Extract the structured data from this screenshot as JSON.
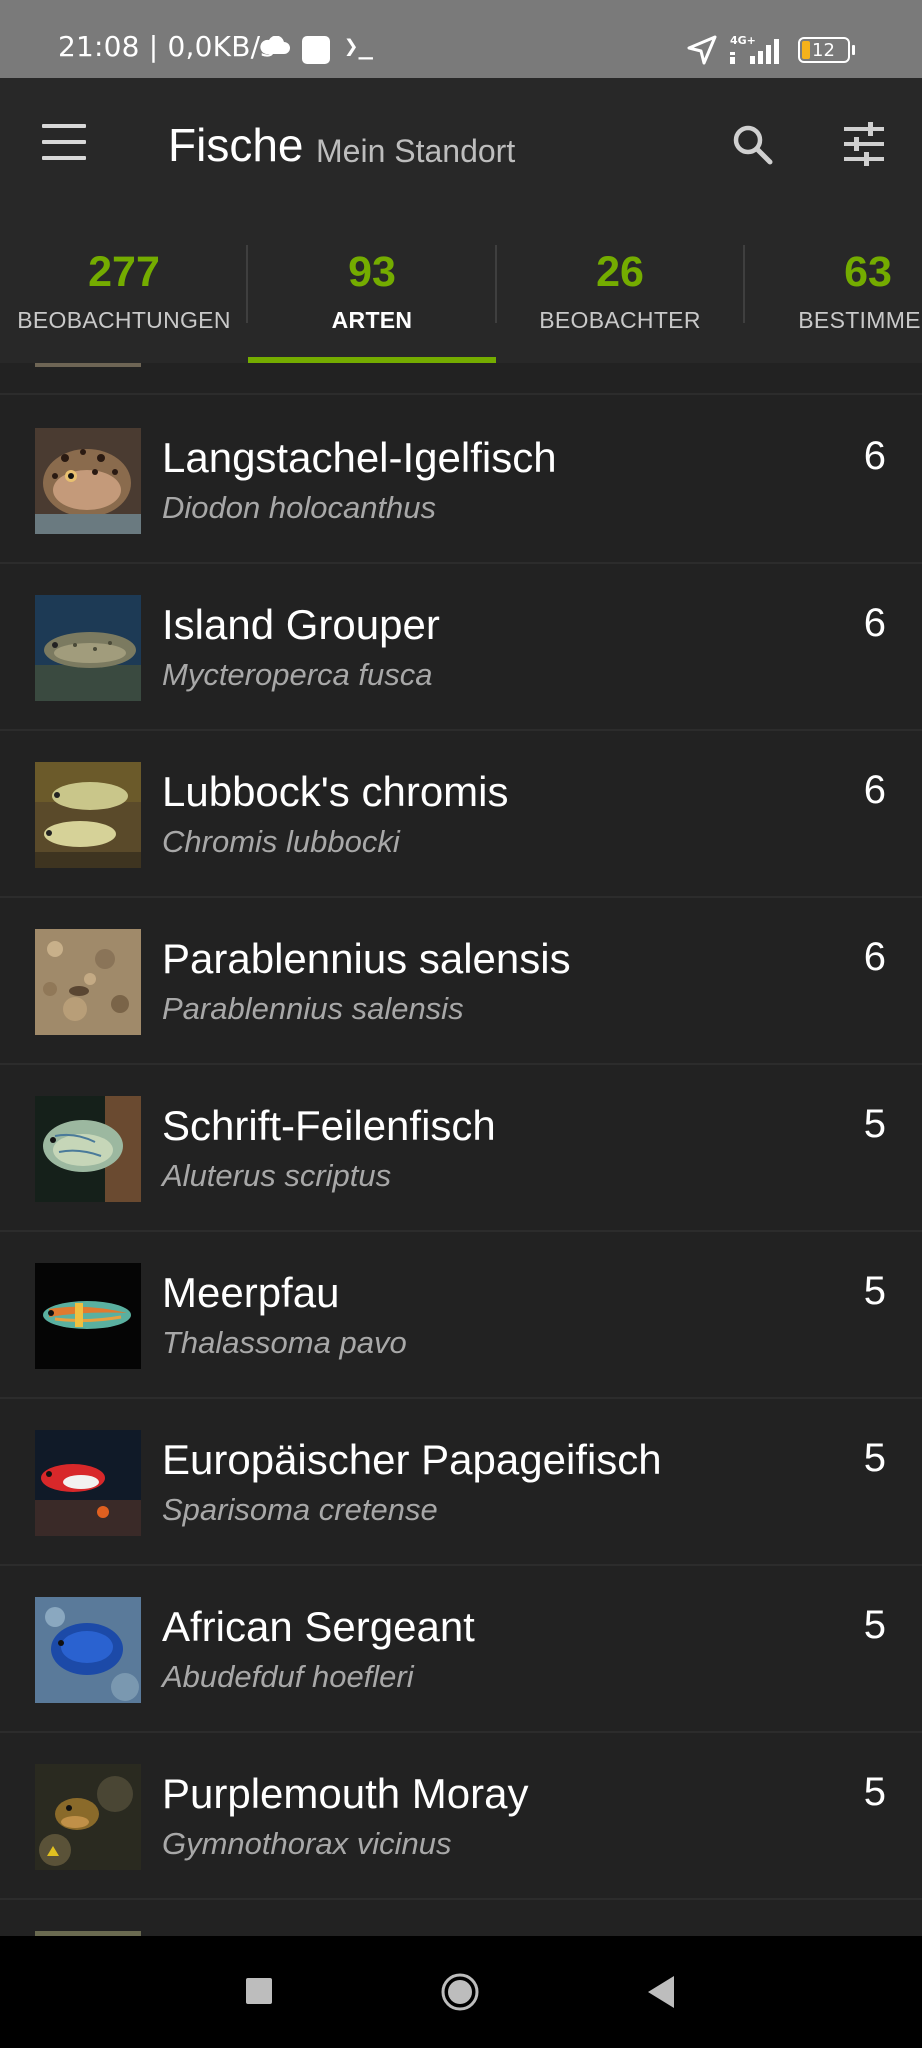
{
  "status_bar": {
    "time_speed": "21:08 | 0,0KB/s",
    "terminal_glyph": "❯_",
    "network_label": "4G+",
    "battery_level": "12",
    "icons": [
      "cloud-icon",
      "notification-square-icon",
      "terminal-icon",
      "location-arrow-icon",
      "signal-icon",
      "battery-icon"
    ]
  },
  "app_bar": {
    "title": "Fische",
    "subtitle": "Mein Standort",
    "icons": [
      "menu-icon",
      "search-icon",
      "filter-sliders-icon"
    ]
  },
  "tabs": [
    {
      "count": "277",
      "label": "BEOBACHTUNGEN",
      "active": false
    },
    {
      "count": "93",
      "label": "ARTEN",
      "active": true
    },
    {
      "count": "26",
      "label": "BEOBACHTER",
      "active": false
    },
    {
      "count": "63",
      "label": "BESTIMMER",
      "active": false
    }
  ],
  "colors": {
    "accent_green": "#74ac00",
    "background": "#222222",
    "app_bar": "#282828",
    "status_bar": "#7a7a7a"
  },
  "species": [
    {
      "common": "Langstachel-Igelfisch",
      "scientific": "Diodon holocanthus",
      "count": "6"
    },
    {
      "common": "Island Grouper",
      "scientific": "Mycteroperca fusca",
      "count": "6"
    },
    {
      "common": "Lubbock's chromis",
      "scientific": "Chromis lubbocki",
      "count": "6"
    },
    {
      "common": "Parablennius salensis",
      "scientific": "Parablennius salensis",
      "count": "6"
    },
    {
      "common": "Schrift-Feilenfisch",
      "scientific": "Aluterus scriptus",
      "count": "5"
    },
    {
      "common": "Meerpfau",
      "scientific": "Thalassoma pavo",
      "count": "5"
    },
    {
      "common": "Europäischer Papageifisch",
      "scientific": "Sparisoma cretense",
      "count": "5"
    },
    {
      "common": "African Sergeant",
      "scientific": "Abudefduf hoefleri",
      "count": "5"
    },
    {
      "common": "Purplemouth Moray",
      "scientific": "Gymnothorax vicinus",
      "count": "5"
    }
  ],
  "nav_bar": {
    "icons": [
      "recent-apps-icon",
      "home-icon",
      "back-icon"
    ]
  }
}
